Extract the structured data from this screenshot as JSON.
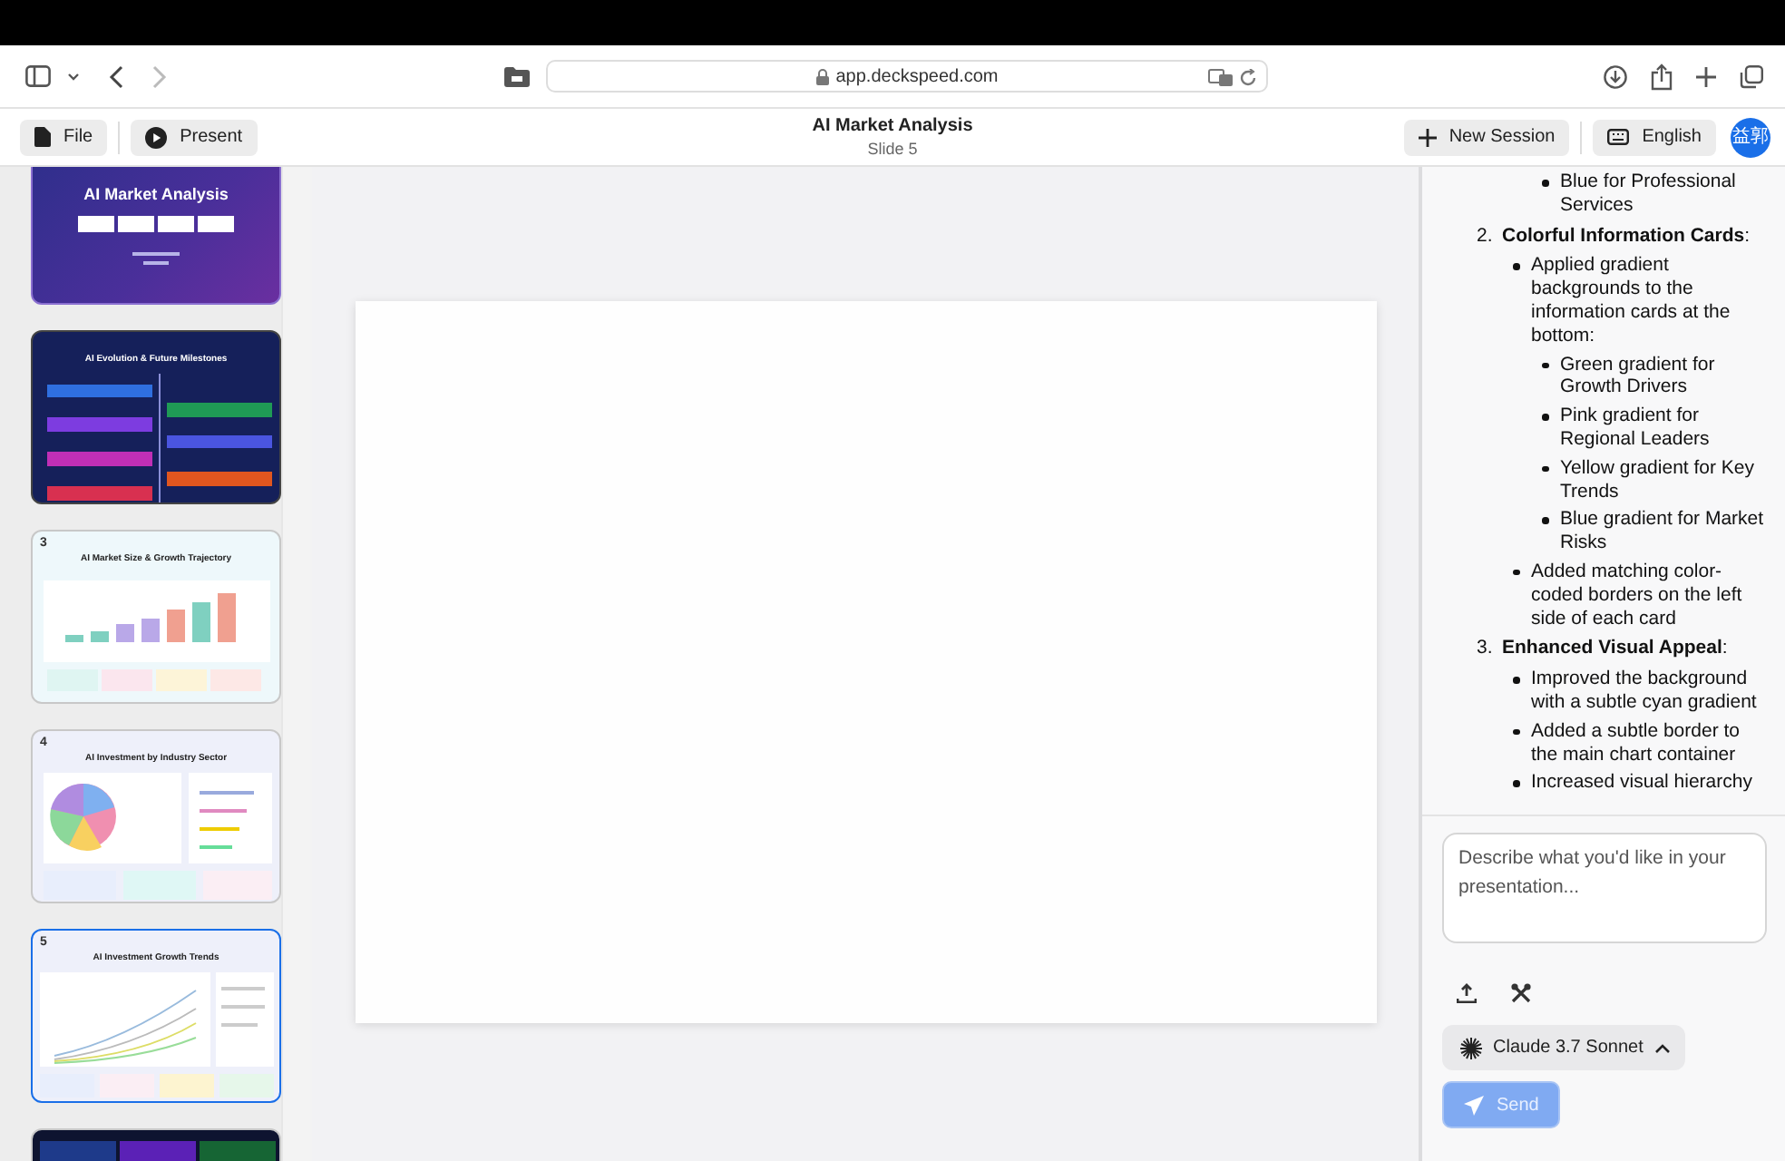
{
  "browser": {
    "url": "app.deckspeed.com",
    "forward_disabled": true
  },
  "toolbar": {
    "left_buttons": [
      {
        "kind": "file",
        "label": "File"
      },
      {
        "kind": "present",
        "label": "Present"
      }
    ],
    "title": "AI Market Analysis",
    "subtitle": "Slide 5",
    "right_buttons": [
      {
        "kind": "new",
        "label": "New Session"
      },
      {
        "kind": "language",
        "label": "English"
      }
    ],
    "avatar": "益郭"
  },
  "slides": [
    {
      "kind": "title",
      "title": "AI Market Analysis",
      "selected": false
    },
    {
      "kind": "timeline",
      "title": "AI Evolution & Future Milestones",
      "selected": false
    },
    {
      "kind": "bar",
      "number": "3",
      "title": "AI Market Size & Growth Trajectory",
      "selected": false
    },
    {
      "kind": "pie",
      "number": "4",
      "title": "AI Investment by Industry Sector",
      "selected": false
    },
    {
      "kind": "line",
      "number": "5",
      "title": "AI Investment Growth Trends",
      "selected": true
    },
    {
      "kind": "sectors",
      "selected": false
    }
  ],
  "chat": {
    "response": [
      {
        "children": [
          {
            "children": [
              {
                "text": "Blue for Professional Services"
              }
            ]
          }
        ]
      },
      {
        "number": "2.",
        "text": "**Colorful Information Cards**:",
        "children": [
          {
            "text": "Applied gradient backgrounds to the information cards at the bottom:",
            "children": [
              {
                "text": "Green gradient for Growth Drivers"
              },
              {
                "text": "Pink gradient for Regional Leaders"
              },
              {
                "text": "Yellow gradient for Key Trends"
              },
              {
                "text": "Blue gradient for Market Risks"
              }
            ]
          },
          {
            "text": "Added matching color-coded borders on the left side of each card"
          }
        ]
      },
      {
        "number": "3.",
        "text": "**Enhanced Visual Appeal**:",
        "children": [
          {
            "text": "Improved the background with a subtle cyan gradient"
          },
          {
            "text": "Added a subtle border to the main chart container"
          },
          {
            "text": "Increased visual hierarchy"
          }
        ]
      }
    ],
    "input": {
      "placeholder": "Describe what you'd like in your presentation..."
    },
    "model": "Claude 3.7 Sonnet",
    "send": {
      "label": "Send",
      "disabled": true
    }
  }
}
